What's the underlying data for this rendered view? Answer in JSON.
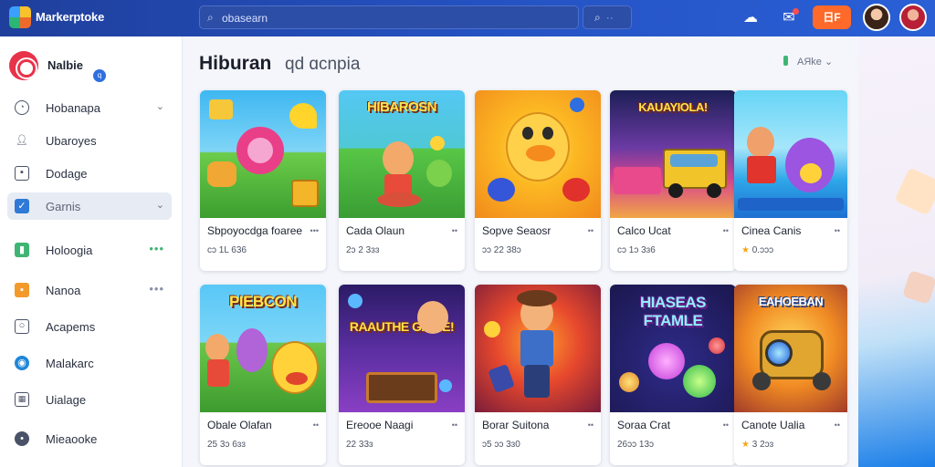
{
  "app": {
    "brand": "Markerptoke",
    "search_placeholder": "obasearn",
    "search_button_dots": "··",
    "cart_label": "日F"
  },
  "sidebar": {
    "profile": {
      "name": "Nalbie",
      "badge": "q"
    },
    "items": [
      {
        "label": "Hobanapa",
        "icon": "clock-icon",
        "trailing": "chevron"
      },
      {
        "label": "Ubaroyes",
        "icon": "user-icon",
        "trailing": ""
      },
      {
        "label": "Dodage",
        "icon": "image-icon",
        "trailing": ""
      },
      {
        "label": "Garnis",
        "icon": "gamepad-icon",
        "trailing": "chevron",
        "active": true
      },
      {
        "label": "Holoogia",
        "icon": "green-app-icon",
        "trailing": "dots",
        "dots_color": "#3fb573"
      },
      {
        "label": "Nanoa",
        "icon": "orange-app-icon",
        "trailing": "dots",
        "dots_color": "#8a91a6"
      },
      {
        "label": "Acapems",
        "icon": "globe-icon",
        "trailing": ""
      },
      {
        "label": "Malakarc",
        "icon": "blue-circle-icon",
        "trailing": ""
      },
      {
        "label": "Uialage",
        "icon": "grid-icon",
        "trailing": ""
      },
      {
        "label": "Mieaooke",
        "icon": "settings-icon",
        "trailing": ""
      }
    ]
  },
  "main": {
    "title": "Hiburan",
    "subtitle": "qd ɑcnpia",
    "sort_label": "AЯke ⌄"
  },
  "cards": [
    {
      "name": "Sbpoyocdga foaree",
      "meta": "cɔ 1L 636",
      "thumb_text": ""
    },
    {
      "name": "Cada Olaun",
      "meta": "2ɔ 2 3ɜɜ",
      "thumb_text": "HIBAROSN"
    },
    {
      "name": "Sopve Seaosr",
      "meta": "ɔɔ 22 38ɔ",
      "thumb_text": ""
    },
    {
      "name": "Calco Ucat",
      "meta": "cɔ 1ɔ 3ɜ6",
      "thumb_text": "KAUAYIOLA!"
    },
    {
      "name": "Cinea Canis",
      "meta": "0.ɔɔɔ",
      "thumb_text": "",
      "rated": true
    },
    {
      "name": "Obale Olafan",
      "meta": "25 3ɔ 6ɜɜ",
      "thumb_text": "PIEBCON"
    },
    {
      "name": "Ereooe Naagi",
      "meta": "22 33ɜ",
      "thumb_text": "RAAUTHE GAIAE!"
    },
    {
      "name": "Borar Suitona",
      "meta": "ɔ5 ɔɔ 3ɜ0",
      "thumb_text": ""
    },
    {
      "name": "Soraa Crat",
      "meta": "26ɔɔ 13ɔ",
      "thumb_text": "HIASEAS FTAMLE"
    },
    {
      "name": "Canote Ualia",
      "meta": "3 2ɔɜ",
      "thumb_text": "EAHOEBAN",
      "rated": true
    }
  ],
  "colors": {
    "topbar": "#2553c4",
    "accent_orange": "#ff6a2a",
    "accent_green": "#3fb573",
    "active_nav": "#e7ebf4"
  }
}
